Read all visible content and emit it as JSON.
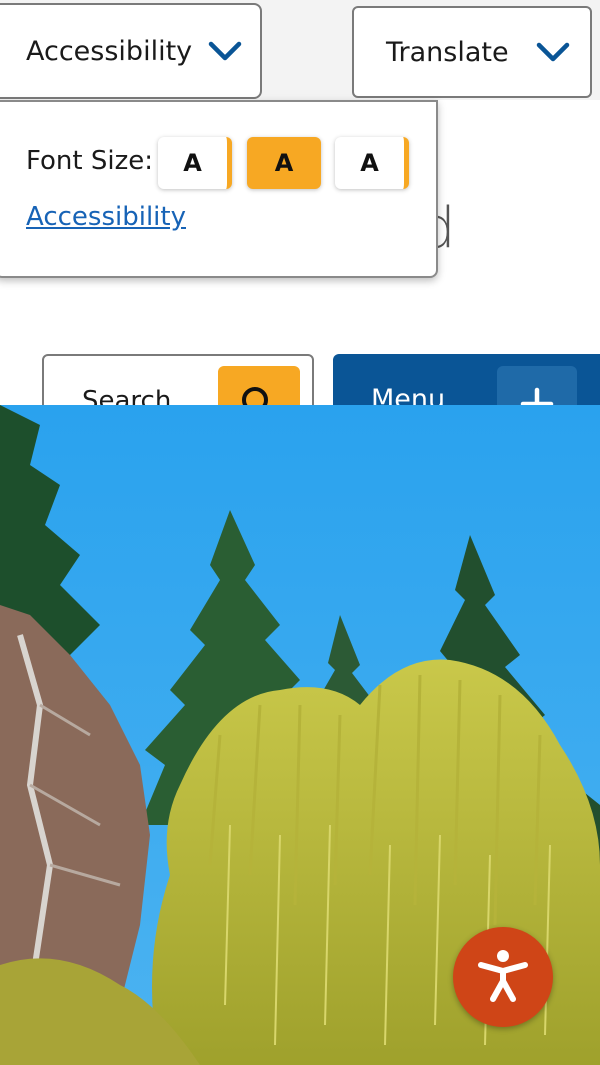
{
  "header": {
    "accessibility_button": {
      "label": "Accessibility",
      "icon": "chevron-down-icon"
    },
    "translate_button": {
      "label": "Translate",
      "icon": "chevron-down-icon"
    },
    "partially_hidden_text": "d"
  },
  "accessibility_panel": {
    "font_size_label": "Font Size:",
    "font_size_options": [
      {
        "label": "A",
        "selected": false
      },
      {
        "label": "A",
        "selected": true
      },
      {
        "label": "A",
        "selected": false
      }
    ],
    "link_label": "Accessibility"
  },
  "search": {
    "placeholder": "Search",
    "button_icon": "search-icon"
  },
  "menu": {
    "label": "Menu",
    "button_icon": "plus-icon"
  },
  "hero": {
    "icon": "hero-photo-trees"
  },
  "floating_widget": {
    "icon": "accessibility-person-icon"
  },
  "colors": {
    "accent": "#f7a823",
    "primary": "#0a5596",
    "link": "#1763b6",
    "accessibility_fab": "#cf4517",
    "sky": "#2aa2ee"
  }
}
